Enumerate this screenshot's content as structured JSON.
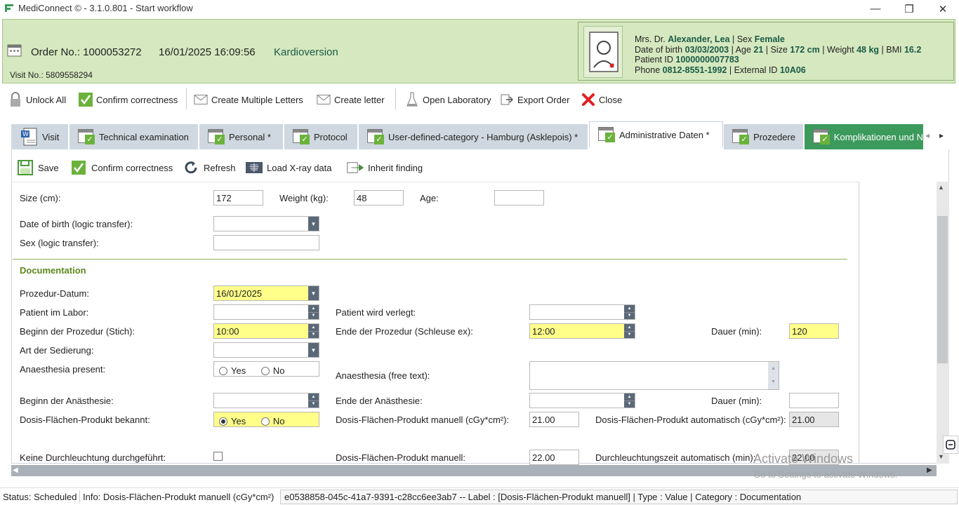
{
  "window": {
    "title": "MediConnect © - 3.1.0.801 - Start workflow",
    "minimize": "—",
    "restore": "❐",
    "close": "✕"
  },
  "header": {
    "order_no": "Order No.: 1000053272",
    "datetime": "16/01/2025 16:09:56",
    "procedure": "Kardioversion",
    "visit_no": "Visit No.: 5809558294",
    "patient": {
      "prefix": "Mrs. Dr.",
      "name": "Alexander, Lea",
      "sex_label": "| Sex",
      "sex": "Female",
      "dob_label": "Date of birth",
      "dob": "03/03/2003",
      "age_label": "| Age",
      "age": "21",
      "size_label": "| Size",
      "size": "172 cm",
      "weight_label": "| Weight",
      "weight": "48 kg",
      "bmi_label": "| BMI",
      "bmi": "16.2",
      "pid_label": "Patient ID",
      "pid": "1000000007783",
      "phone_label": "Phone",
      "phone": "0812-8551-1992",
      "ext_label": "| External ID",
      "ext_id": "10A06"
    }
  },
  "toolbar": {
    "unlock_all": "Unlock All",
    "confirm": "Confirm correctness",
    "multi_letters": "Create Multiple Letters",
    "create_letter": "Create letter",
    "open_lab": "Open Laboratory",
    "export_order": "Export Order",
    "close": "Close"
  },
  "tabs": [
    {
      "label": "Visit"
    },
    {
      "label": "Technical examination"
    },
    {
      "label": "Personal *"
    },
    {
      "label": "Protocol"
    },
    {
      "label": "User-defined-category - Hamburg (Asklepois) *"
    },
    {
      "label": "Administrative Daten *"
    },
    {
      "label": "Prozedere"
    },
    {
      "label": "Komplikationen und N"
    }
  ],
  "tab_nav": {
    "prev": "◂",
    "next": "▸"
  },
  "inner_toolbar": {
    "save": "Save",
    "confirm": "Confirm correctness",
    "refresh": "Refresh",
    "load_xray": "Load X-ray data",
    "inherit": "Inherit finding"
  },
  "form": {
    "size_label": "Size (cm):",
    "size_value": "172",
    "weight_label": "Weight (kg):",
    "weight_value": "48",
    "age_label": "Age:",
    "age_value": "",
    "dob_label": "Date of birth (logic transfer):",
    "sex_label": "Sex (logic transfer):",
    "section_title": "Documentation",
    "prozedur_datum_label": "Prozedur-Datum:",
    "prozedur_datum_value": "16/01/2025",
    "patient_labor_label": "Patient im Labor:",
    "patient_verlegt_label": "Patient wird verlegt:",
    "beginn_label": "Beginn der Prozedur (Stich):",
    "beginn_value": "10:00",
    "ende_label": "Ende der Prozedur (Schleuse ex):",
    "ende_value": "12:00",
    "dauer_label": "Dauer (min):",
    "dauer_value": "120",
    "sedierung_label": "Art der Sedierung:",
    "anaesthesia_present_label": "Anaesthesia present:",
    "yes": "Yes",
    "no": "No",
    "anaesthesia_free_label": "Anaesthesia (free text):",
    "beginn_anaesthesie_label": "Beginn der Anästhesie:",
    "ende_anaesthesie_label": "Ende der Anästhesie:",
    "dauer2_label": "Dauer (min):",
    "dfp_bekannt_label": "Dosis-Flächen-Produkt bekannt:",
    "dfp_manuell_label": "Dosis-Flächen-Produkt manuell (cGy*cm²):",
    "dfp_manuell_value": "21.00",
    "dfp_auto_label": "Dosis-Flächen-Produkt automatisch (cGy*cm²):",
    "dfp_auto_value": "21.00",
    "keine_label": "Keine Durchleuchtung durchgeführt:",
    "dfp_manuell2_label": "Dosis-Flächen-Produkt manuell:",
    "dfp_manuell2_value": "22.00",
    "dl_zeit_label": "Durchleuchtungszeit automatisch (min):",
    "dl_zeit_value": "22.00"
  },
  "watermark": {
    "line1": "Activate Windows",
    "line2": "Go to Settings to activate Windows."
  },
  "status": {
    "status": "Status: Scheduled",
    "info": "Info: Dosis-Flächen-Produkt manuell (cGy*cm²)",
    "detail": "e0538858-045c-41a7-9391-c28cc6ee3ab7  -- Label : [Dosis-Flächen-Produkt manuell] | Type : Value | Category : Documentation"
  },
  "colors": {
    "header_bg": "#d5e8bf",
    "accent_green": "#1a5a46",
    "required_yellow": "#ffff8a",
    "tab_bg": "#cfd8e0",
    "tab_green": "#3c9a5c"
  }
}
